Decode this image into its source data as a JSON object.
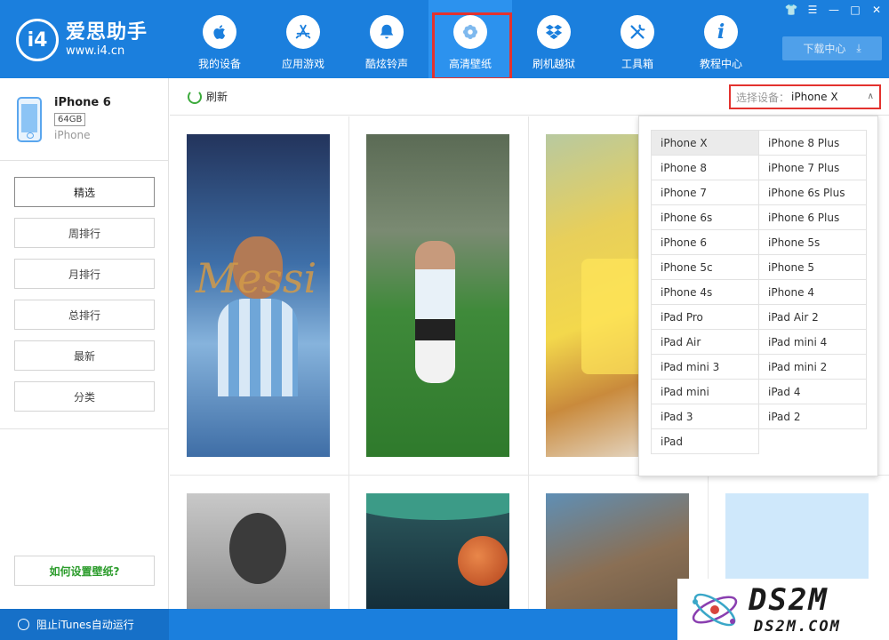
{
  "app": {
    "name": "爱思助手",
    "url": "www.i4.cn",
    "logo_mark": "i4"
  },
  "nav": [
    {
      "label": "我的设备",
      "icon": "apple-icon"
    },
    {
      "label": "应用游戏",
      "icon": "app-store-icon"
    },
    {
      "label": "酷炫铃声",
      "icon": "bell-icon"
    },
    {
      "label": "高清壁纸",
      "icon": "flower-icon",
      "active": true
    },
    {
      "label": "刷机越狱",
      "icon": "dropbox-icon"
    },
    {
      "label": "工具箱",
      "icon": "tools-icon"
    },
    {
      "label": "教程中心",
      "icon": "info-icon"
    }
  ],
  "window_controls": [
    "shirt-icon",
    "menu-icon",
    "minimize-icon",
    "maximize-icon",
    "close-icon"
  ],
  "download_center": "下载中心",
  "device": {
    "name": "iPhone 6",
    "capacity": "64GB",
    "type": "iPhone"
  },
  "side_menu": [
    "精选",
    "周排行",
    "月排行",
    "总排行",
    "最新",
    "分类"
  ],
  "howto": "如何设置壁纸?",
  "toolbar": {
    "refresh": "刷新",
    "select_label": "选择设备：",
    "select_value": "iPhone X"
  },
  "wallpaper_thumbs": {
    "messi_word": "Messi"
  },
  "dropdown_options": [
    "iPhone X",
    "iPhone 8 Plus",
    "iPhone 8",
    "iPhone 7 Plus",
    "iPhone 7",
    "iPhone 6s Plus",
    "iPhone 6s",
    "iPhone 6 Plus",
    "iPhone 6",
    "iPhone 5s",
    "iPhone 5c",
    "iPhone 5",
    "iPhone 4s",
    "iPhone 4",
    "iPad Pro",
    "iPad Air 2",
    "iPad Air",
    "iPad mini 4",
    "iPad mini 3",
    "iPad mini 2",
    "iPad mini",
    "iPad 4",
    "iPad 3",
    "iPad 2",
    "iPad"
  ],
  "footer": {
    "itunes_block": "阻止iTunes自动运行"
  },
  "watermark": {
    "main": "DS2M",
    "sub": "DS2M.COM"
  },
  "colors": {
    "brand_blue": "#1b7fdd",
    "highlight_red": "#e3322e",
    "howto_green": "#2a9b2a"
  }
}
